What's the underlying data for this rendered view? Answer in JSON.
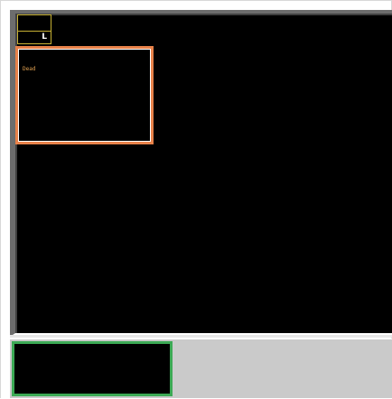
{
  "status_indicator": {
    "letter": "L"
  },
  "info_panel": {
    "status_text": "Dead"
  },
  "colors": {
    "viewport_bg": "#000000",
    "status_border": "#c8b234",
    "info_panel_border": "#e8824a",
    "status_text": "#e0a050",
    "minimap_border": "#3caa55",
    "bottom_bar_bg": "#cacaca"
  }
}
